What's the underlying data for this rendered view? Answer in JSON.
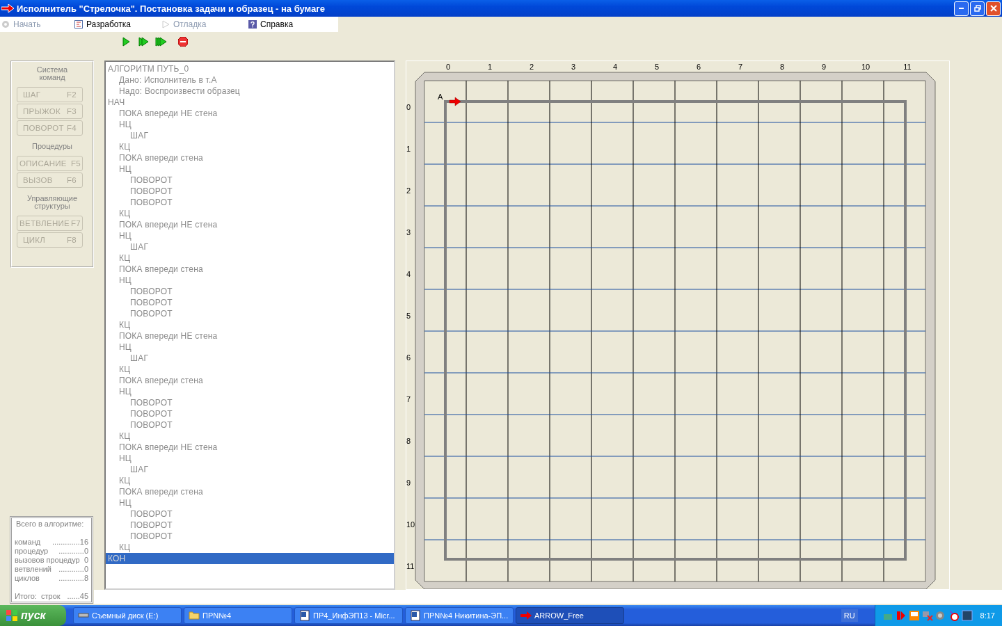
{
  "window": {
    "title": "Исполнитель \"Стрелочка\". Постановка задачи и образец - на бумаге"
  },
  "menu": [
    {
      "label": "Начать",
      "kind": "start",
      "disabled": true
    },
    {
      "label": "Разработка",
      "kind": "develop",
      "disabled": false
    },
    {
      "label": "Отладка",
      "kind": "debug",
      "disabled": true
    },
    {
      "label": "Справка",
      "kind": "help",
      "disabled": false
    }
  ],
  "command_panel": {
    "sections": [
      {
        "title": "Система команд",
        "buttons": [
          {
            "label": "ШАГ",
            "key": "F2",
            "disabled": true
          },
          {
            "label": "ПРЫЖОК",
            "key": "F3",
            "disabled": true
          },
          {
            "label": "ПОВОРОТ",
            "key": "F4",
            "disabled": true
          }
        ]
      },
      {
        "title": "Процедуры",
        "buttons": [
          {
            "label": "ОПИСАНИЕ",
            "key": "F5",
            "disabled": true
          },
          {
            "label": "ВЫЗОВ",
            "key": "F6",
            "disabled": true
          }
        ]
      },
      {
        "title": "Управляющие структуры",
        "buttons": [
          {
            "label": "ВЕТВЛЕНИЕ",
            "key": "F7",
            "disabled": true
          },
          {
            "label": "ЦИКЛ",
            "key": "F8",
            "disabled": true
          }
        ]
      }
    ]
  },
  "stats": {
    "title": "Всего в алгоритме:",
    "rows": [
      {
        "label": "команд",
        "value": ".............16"
      },
      {
        "label": "процедур",
        "value": "............0"
      },
      {
        "label": "вызовов процедур",
        "value": "0"
      },
      {
        "label": "ветвлений",
        "value": "............0"
      },
      {
        "label": "циклов",
        "value": "............8"
      }
    ],
    "total": {
      "label": "Итого:  строк",
      "value": "......45"
    }
  },
  "program": {
    "lines": [
      {
        "text": "АЛГОРИТМ ПУТЬ_0",
        "selected": false,
        "children": [
          {
            "text": "Дано: Исполнитель в т.А",
            "selected": false
          },
          {
            "text": "Надо: Воспроизвести образец",
            "selected": false
          }
        ]
      },
      {
        "text": "НАЧ",
        "selected": false,
        "children": [
          {
            "text": "ПОКА впереди НЕ стена",
            "selected": false
          },
          {
            "text": "НЦ",
            "selected": false,
            "children": [
              {
                "text": "ШАГ",
                "selected": false
              }
            ]
          },
          {
            "text": "КЦ",
            "selected": false
          },
          {
            "text": "ПОКА впереди стена",
            "selected": false
          },
          {
            "text": "НЦ",
            "selected": false,
            "children": [
              {
                "text": "ПОВОРОТ",
                "selected": false
              },
              {
                "text": "ПОВОРОТ",
                "selected": false
              },
              {
                "text": "ПОВОРОТ",
                "selected": false
              }
            ]
          },
          {
            "text": "КЦ",
            "selected": false
          },
          {
            "text": "ПОКА впереди НЕ стена",
            "selected": false
          },
          {
            "text": "НЦ",
            "selected": false,
            "children": [
              {
                "text": "ШАГ",
                "selected": false
              }
            ]
          },
          {
            "text": "КЦ",
            "selected": false
          },
          {
            "text": "ПОКА впереди стена",
            "selected": false
          },
          {
            "text": "НЦ",
            "selected": false,
            "children": [
              {
                "text": "ПОВОРОТ",
                "selected": false
              },
              {
                "text": "ПОВОРОТ",
                "selected": false
              },
              {
                "text": "ПОВОРОТ",
                "selected": false
              }
            ]
          },
          {
            "text": "КЦ",
            "selected": false
          },
          {
            "text": "ПОКА впереди НЕ стена",
            "selected": false
          },
          {
            "text": "НЦ",
            "selected": false,
            "children": [
              {
                "text": "ШАГ",
                "selected": false
              }
            ]
          },
          {
            "text": "КЦ",
            "selected": false
          },
          {
            "text": "ПОКА впереди стена",
            "selected": false
          },
          {
            "text": "НЦ",
            "selected": false,
            "children": [
              {
                "text": "ПОВОРОТ",
                "selected": false
              },
              {
                "text": "ПОВОРОТ",
                "selected": false
              },
              {
                "text": "ПОВОРОТ",
                "selected": false
              }
            ]
          },
          {
            "text": "КЦ",
            "selected": false
          },
          {
            "text": "ПОКА впереди НЕ стена",
            "selected": false
          },
          {
            "text": "НЦ",
            "selected": false,
            "children": [
              {
                "text": "ШАГ",
                "selected": false
              }
            ]
          },
          {
            "text": "КЦ",
            "selected": false
          },
          {
            "text": "ПОКА впереди стена",
            "selected": false
          },
          {
            "text": "НЦ",
            "selected": false,
            "children": [
              {
                "text": "ПОВОРОТ",
                "selected": false
              },
              {
                "text": "ПОВОРОТ",
                "selected": false
              },
              {
                "text": "ПОВОРОТ",
                "selected": false
              }
            ]
          },
          {
            "text": "КЦ",
            "selected": false
          }
        ]
      },
      {
        "text": "КОН",
        "selected": true
      }
    ]
  },
  "board": {
    "columns": [
      "0",
      "1",
      "2",
      "3",
      "4",
      "5",
      "6",
      "7",
      "8",
      "9",
      "10",
      "11"
    ],
    "rows": [
      "0",
      "1",
      "2",
      "3",
      "4",
      "5",
      "6",
      "7",
      "8",
      "9",
      "10",
      "11"
    ],
    "start_label": "A"
  },
  "taskbar": {
    "start": "пуск",
    "tasks": [
      {
        "label": "Съемный диск (E:)",
        "kind": "drive",
        "selected": false
      },
      {
        "label": "ПРN№4",
        "kind": "folder",
        "selected": false
      },
      {
        "label": "ПР4_ИнфЭП13 - Micr...",
        "kind": "document",
        "selected": false
      },
      {
        "label": "ПРN№4 Никитина-ЭП...",
        "kind": "document",
        "selected": false
      },
      {
        "label": "ARROW_Free",
        "kind": "arrow",
        "selected": true
      }
    ],
    "language": "RU",
    "clock": "8:17"
  }
}
